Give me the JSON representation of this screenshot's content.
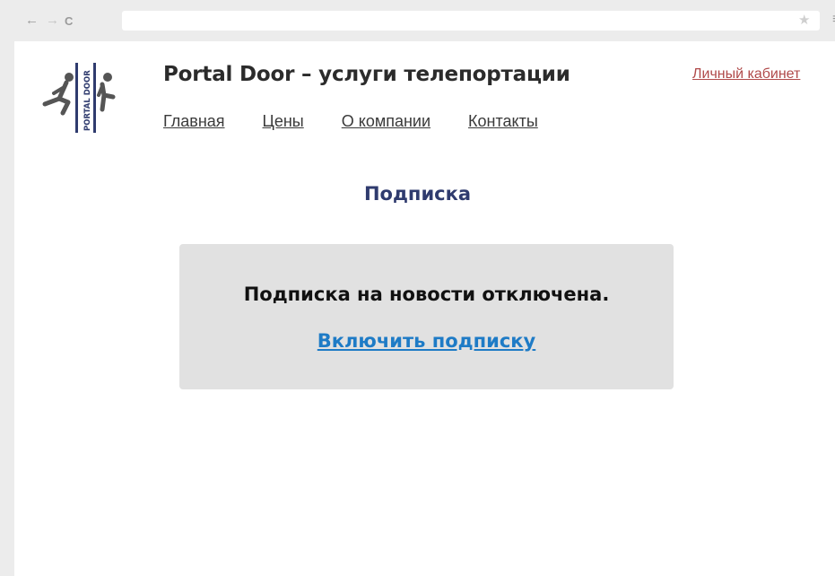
{
  "browser": {
    "back_icon": "←",
    "forward_icon": "→",
    "reload_icon": "C",
    "url": "",
    "bookmark_icon": "★",
    "menu_icon": "≡"
  },
  "header": {
    "logo_text": "PORTAL DOOR",
    "title": "Portal Door – услуги телепортации",
    "account_link": "Личный кабинет",
    "nav": [
      {
        "label": "Главная"
      },
      {
        "label": "Цены"
      },
      {
        "label": "О компании"
      },
      {
        "label": "Контакты"
      }
    ]
  },
  "main": {
    "heading": "Подписка",
    "notice_text": "Подписка на новости отключена.",
    "notice_link": "Включить подписку"
  },
  "colors": {
    "heading": "#2f3b6e",
    "link": "#1e7bc6",
    "account_link": "#b04a4a",
    "notice_bg": "#e1e1e1",
    "logo_blue": "#2f3b6e"
  }
}
